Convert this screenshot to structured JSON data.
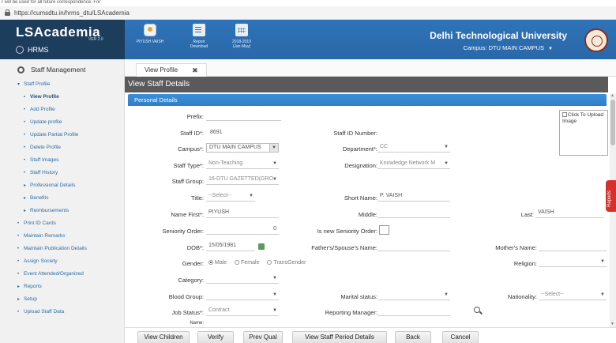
{
  "browser": {
    "clipped_text": "r will be used for all future correspondence. For",
    "url": "https://cumsdtu.in/hrms_dtu/LSAcademia"
  },
  "brand": {
    "logo": "LSAcademia",
    "version": "VER 2.0",
    "module": "HRMS"
  },
  "topbar": {
    "items": [
      {
        "label": "PIYUSH VAISH",
        "icon": "user-avatar-icon"
      },
      {
        "label": "Report\nDownload",
        "icon": "report-download-icon"
      },
      {
        "label": "2018-2019\n(Jan-May)",
        "icon": "calendar-icon"
      }
    ],
    "university": "Delhi Technological University",
    "campus": "Campus: DTU MAIN CAMPUS"
  },
  "sidebar": {
    "header": "Staff Management",
    "items": [
      {
        "label": "Staff Profile",
        "marker": "▾",
        "level": 1
      },
      {
        "label": "View Profile",
        "marker": "•",
        "level": 2,
        "active": true
      },
      {
        "label": "Add Profile",
        "marker": "•",
        "level": 2
      },
      {
        "label": "Update profile",
        "marker": "•",
        "level": 2
      },
      {
        "label": "Update Partial Profile",
        "marker": "•",
        "level": 2
      },
      {
        "label": "Delete Profile",
        "marker": "•",
        "level": 2
      },
      {
        "label": "Staff Images",
        "marker": "•",
        "level": 2
      },
      {
        "label": "Staff History",
        "marker": "•",
        "level": 2
      },
      {
        "label": "Professional Details",
        "marker": "▸",
        "level": 2
      },
      {
        "label": "Benefits",
        "marker": "▸",
        "level": 2
      },
      {
        "label": "Reimbursements",
        "marker": "▸",
        "level": 2
      },
      {
        "label": "Print ID Cards",
        "marker": "•",
        "level": 1
      },
      {
        "label": "Maintain Remarks",
        "marker": "•",
        "level": 1
      },
      {
        "label": "Maintain Publication Details",
        "marker": "•",
        "level": 1
      },
      {
        "label": "Assign Society",
        "marker": "•",
        "level": 1
      },
      {
        "label": "Event Attended/Organized",
        "marker": "•",
        "level": 1
      },
      {
        "label": "Reports",
        "marker": "▸",
        "level": 1
      },
      {
        "label": "Setup",
        "marker": "▸",
        "level": 1
      },
      {
        "label": "Upload Staff Data",
        "marker": "•",
        "level": 1
      }
    ]
  },
  "tab": {
    "label": "View Profile",
    "close": "✖"
  },
  "page_title": "View Staff Details",
  "section_title": "Personal Details",
  "photo": {
    "text": "Click To Upload Image"
  },
  "form": {
    "prefix": {
      "label": "Prefix:",
      "value": ""
    },
    "staff_id": {
      "label": "Staff ID*:",
      "value": "8691"
    },
    "staff_id_number": {
      "label": "Staff ID Number:",
      "value": ""
    },
    "campus": {
      "label": "Campus*:",
      "value": "DTU MAIN CAMPUS"
    },
    "department": {
      "label": "Department*:",
      "value": "CC"
    },
    "staff_type": {
      "label": "Staff Type*:",
      "value": "Non-Teaching"
    },
    "designation": {
      "label": "Designation:",
      "value": "Knowledge Network M"
    },
    "staff_group": {
      "label": "Staff Group:",
      "value": "16-DTU GAZETTED(GRO"
    },
    "title": {
      "label": "Title:",
      "value": "--Select--"
    },
    "short_name": {
      "label": "Short Name:",
      "value": "P. VAISH"
    },
    "name_first": {
      "label": "Name First*:",
      "value": "PIYUSH"
    },
    "middle": {
      "label": "Middle:",
      "value": ""
    },
    "last": {
      "label": "Last:",
      "value": "VAISH"
    },
    "seniority_order": {
      "label": "Seniority Order:",
      "value": "0"
    },
    "is_new_seniority": {
      "label": "Is new Seniority Order:"
    },
    "dob": {
      "label": "DOB*:",
      "value": "15/05/1981"
    },
    "father_name": {
      "label": "Father's/Spouse's Name:",
      "value": ""
    },
    "mother_name": {
      "label": "Mother's Name:",
      "value": ""
    },
    "gender": {
      "label": "Gender:",
      "options": [
        "Male",
        "Female",
        "TransGender"
      ],
      "selected": "Male"
    },
    "religion": {
      "label": "Religion:",
      "value": ""
    },
    "category": {
      "label": "Category:",
      "value": ""
    },
    "blood_group": {
      "label": "Blood Group:",
      "value": ""
    },
    "marital_status": {
      "label": "Marital status:",
      "value": ""
    },
    "nationality": {
      "label": "Nationality:",
      "value": "--Select--"
    },
    "job_status": {
      "label": "Job Status*:",
      "value": "Contract"
    },
    "reporting_manager": {
      "label": "Reporting Manager:",
      "value": ""
    },
    "name_partial": {
      "label": "Name:"
    }
  },
  "side_tab": {
    "label": "Reports"
  },
  "footer_buttons": [
    "View Children",
    "Verify",
    "Prev Qual",
    "View Staff Period Details",
    "Back",
    "Cancel"
  ]
}
